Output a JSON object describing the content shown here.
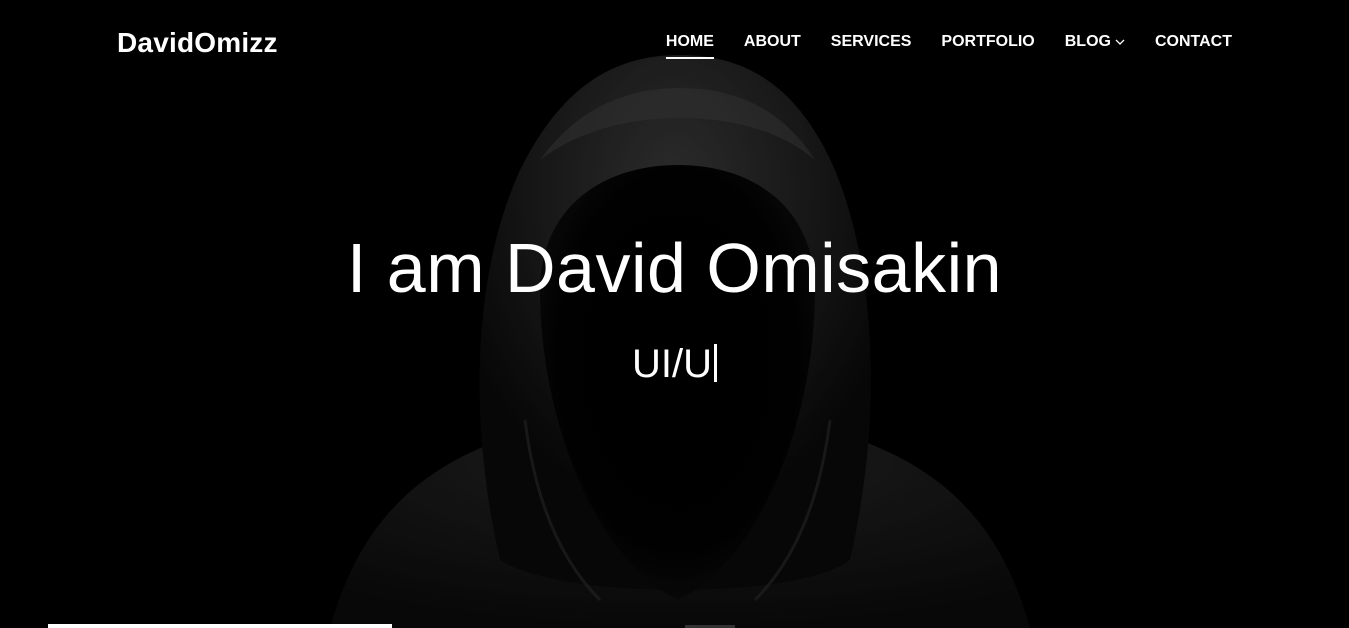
{
  "header": {
    "brand": "DavidOmizz",
    "nav": [
      {
        "label": "HOME",
        "active": true
      },
      {
        "label": "ABOUT",
        "active": false
      },
      {
        "label": "SERVICES",
        "active": false
      },
      {
        "label": "PORTFOLIO",
        "active": false
      },
      {
        "label": "BLOG",
        "active": false,
        "dropdown": true
      },
      {
        "label": "CONTACT",
        "active": false
      }
    ]
  },
  "hero": {
    "title": "I am David Omisakin",
    "typed_text": "UI/U",
    "background_image": "hooded-figure-photo"
  },
  "colors": {
    "background": "#000000",
    "text": "#ffffff",
    "hood": "#2a2a2a"
  }
}
